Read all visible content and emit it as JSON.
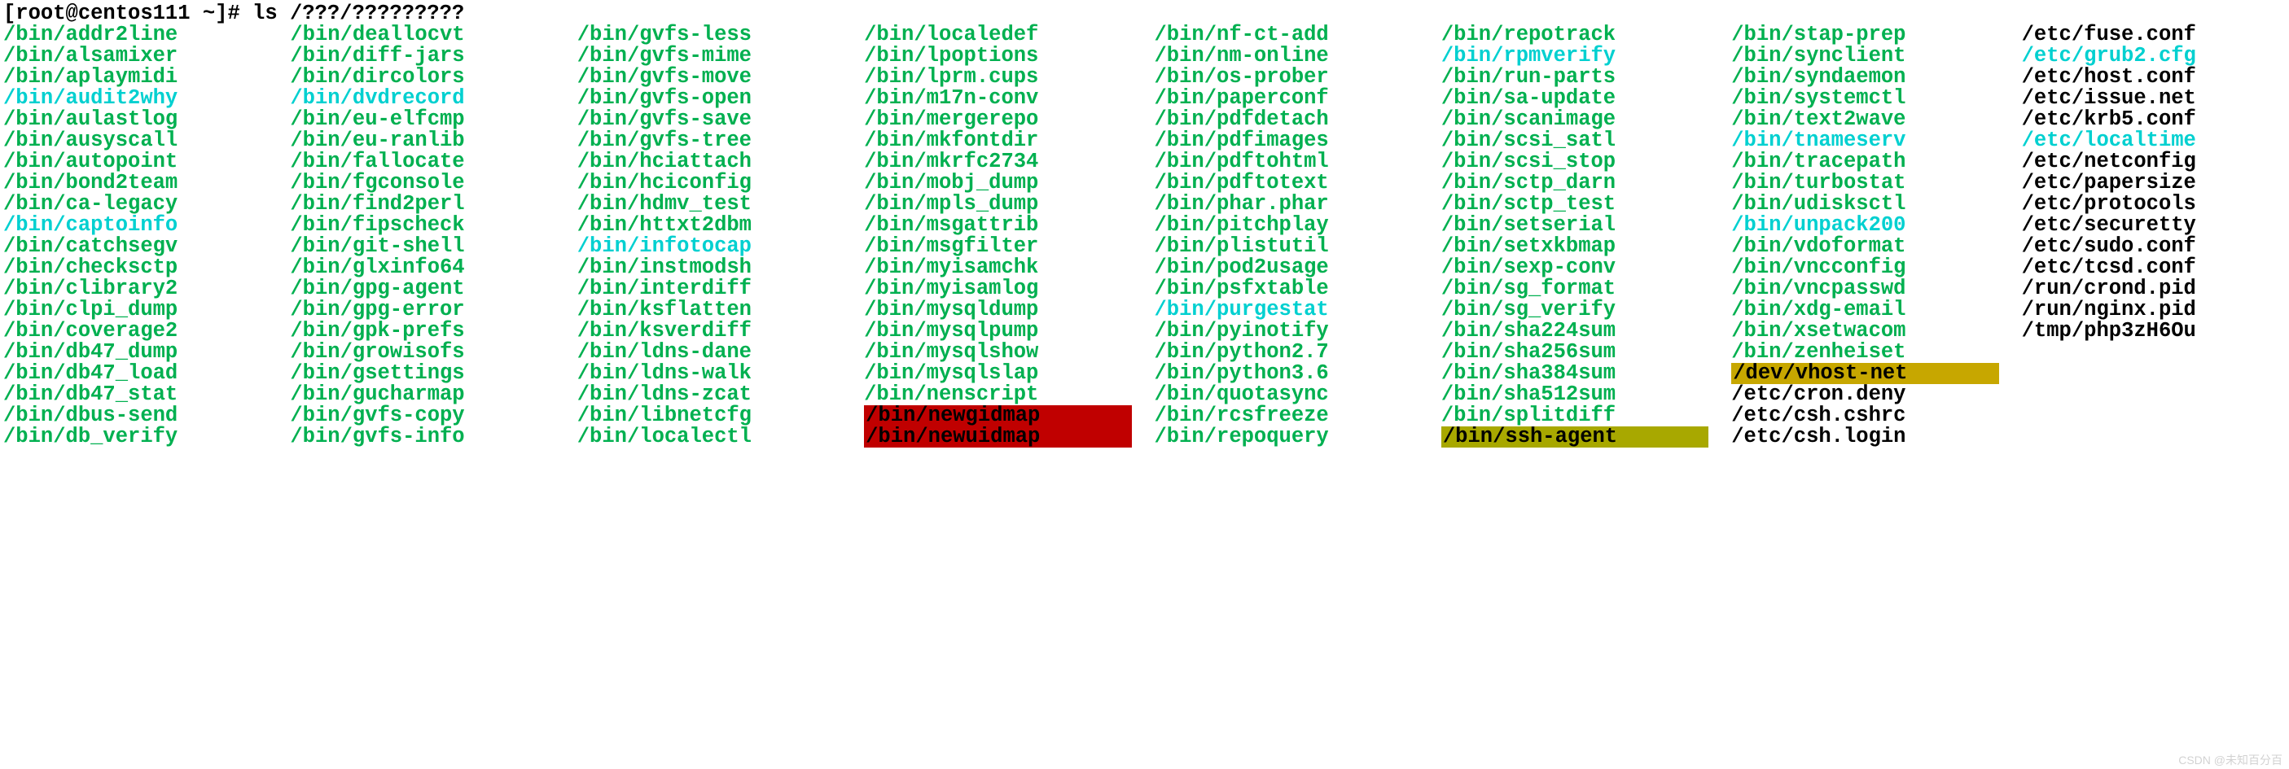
{
  "prompt": "[root@centos111 ~]# ls  /???/?????????",
  "watermark": "CSDN @未知百分百",
  "columns": [
    [
      {
        "text": "/bin/addr2line",
        "cls": "green"
      },
      {
        "text": "/bin/alsamixer",
        "cls": "green"
      },
      {
        "text": "/bin/aplaymidi",
        "cls": "green"
      },
      {
        "text": "/bin/audit2why",
        "cls": "cyan"
      },
      {
        "text": "/bin/aulastlog",
        "cls": "green"
      },
      {
        "text": "/bin/ausyscall",
        "cls": "green"
      },
      {
        "text": "/bin/autopoint",
        "cls": "green"
      },
      {
        "text": "/bin/bond2team",
        "cls": "green"
      },
      {
        "text": "/bin/ca-legacy",
        "cls": "green"
      },
      {
        "text": "/bin/captoinfo",
        "cls": "cyan"
      },
      {
        "text": "/bin/catchsegv",
        "cls": "green"
      },
      {
        "text": "/bin/checksctp",
        "cls": "green"
      },
      {
        "text": "/bin/clibrary2",
        "cls": "green"
      },
      {
        "text": "/bin/clpi_dump",
        "cls": "green"
      },
      {
        "text": "/bin/coverage2",
        "cls": "green"
      },
      {
        "text": "/bin/db47_dump",
        "cls": "green"
      },
      {
        "text": "/bin/db47_load",
        "cls": "green"
      },
      {
        "text": "/bin/db47_stat",
        "cls": "green"
      },
      {
        "text": "/bin/dbus-send",
        "cls": "green"
      },
      {
        "text": "/bin/db_verify",
        "cls": "green"
      }
    ],
    [
      {
        "text": "/bin/deallocvt",
        "cls": "green"
      },
      {
        "text": "/bin/diff-jars",
        "cls": "green"
      },
      {
        "text": "/bin/dircolors",
        "cls": "green"
      },
      {
        "text": "/bin/dvdrecord",
        "cls": "cyan"
      },
      {
        "text": "/bin/eu-elfcmp",
        "cls": "green"
      },
      {
        "text": "/bin/eu-ranlib",
        "cls": "green"
      },
      {
        "text": "/bin/fallocate",
        "cls": "green"
      },
      {
        "text": "/bin/fgconsole",
        "cls": "green"
      },
      {
        "text": "/bin/find2perl",
        "cls": "green"
      },
      {
        "text": "/bin/fipscheck",
        "cls": "green"
      },
      {
        "text": "/bin/git-shell",
        "cls": "green"
      },
      {
        "text": "/bin/glxinfo64",
        "cls": "green"
      },
      {
        "text": "/bin/gpg-agent",
        "cls": "green"
      },
      {
        "text": "/bin/gpg-error",
        "cls": "green"
      },
      {
        "text": "/bin/gpk-prefs",
        "cls": "green"
      },
      {
        "text": "/bin/growisofs",
        "cls": "green"
      },
      {
        "text": "/bin/gsettings",
        "cls": "green"
      },
      {
        "text": "/bin/gucharmap",
        "cls": "green"
      },
      {
        "text": "/bin/gvfs-copy",
        "cls": "green"
      },
      {
        "text": "/bin/gvfs-info",
        "cls": "green"
      }
    ],
    [
      {
        "text": "/bin/gvfs-less",
        "cls": "green"
      },
      {
        "text": "/bin/gvfs-mime",
        "cls": "green"
      },
      {
        "text": "/bin/gvfs-move",
        "cls": "green"
      },
      {
        "text": "/bin/gvfs-open",
        "cls": "green"
      },
      {
        "text": "/bin/gvfs-save",
        "cls": "green"
      },
      {
        "text": "/bin/gvfs-tree",
        "cls": "green"
      },
      {
        "text": "/bin/hciattach",
        "cls": "green"
      },
      {
        "text": "/bin/hciconfig",
        "cls": "green"
      },
      {
        "text": "/bin/hdmv_test",
        "cls": "green"
      },
      {
        "text": "/bin/httxt2dbm",
        "cls": "green"
      },
      {
        "text": "/bin/infotocap",
        "cls": "cyan"
      },
      {
        "text": "/bin/instmodsh",
        "cls": "green"
      },
      {
        "text": "/bin/interdiff",
        "cls": "green"
      },
      {
        "text": "/bin/ksflatten",
        "cls": "green"
      },
      {
        "text": "/bin/ksverdiff",
        "cls": "green"
      },
      {
        "text": "/bin/ldns-dane",
        "cls": "green"
      },
      {
        "text": "/bin/ldns-walk",
        "cls": "green"
      },
      {
        "text": "/bin/ldns-zcat",
        "cls": "green"
      },
      {
        "text": "/bin/libnetcfg",
        "cls": "green"
      },
      {
        "text": "/bin/localectl",
        "cls": "green"
      }
    ],
    [
      {
        "text": "/bin/localedef",
        "cls": "green"
      },
      {
        "text": "/bin/lpoptions",
        "cls": "green"
      },
      {
        "text": "/bin/lprm.cups",
        "cls": "green"
      },
      {
        "text": "/bin/m17n-conv",
        "cls": "green"
      },
      {
        "text": "/bin/mergerepo",
        "cls": "green"
      },
      {
        "text": "/bin/mkfontdir",
        "cls": "green"
      },
      {
        "text": "/bin/mkrfc2734",
        "cls": "green"
      },
      {
        "text": "/bin/mobj_dump",
        "cls": "green"
      },
      {
        "text": "/bin/mpls_dump",
        "cls": "green"
      },
      {
        "text": "/bin/msgattrib",
        "cls": "green"
      },
      {
        "text": "/bin/msgfilter",
        "cls": "green"
      },
      {
        "text": "/bin/myisamchk",
        "cls": "green"
      },
      {
        "text": "/bin/myisamlog",
        "cls": "green"
      },
      {
        "text": "/bin/mysqldump",
        "cls": "green"
      },
      {
        "text": "/bin/mysqlpump",
        "cls": "green"
      },
      {
        "text": "/bin/mysqlshow",
        "cls": "green"
      },
      {
        "text": "/bin/mysqlslap",
        "cls": "green"
      },
      {
        "text": "/bin/nenscript",
        "cls": "green"
      },
      {
        "text": "/bin/newgidmap",
        "cls": "red-bg-black"
      },
      {
        "text": "/bin/newuidmap",
        "cls": "red-bg-black"
      }
    ],
    [
      {
        "text": "/bin/nf-ct-add",
        "cls": "green"
      },
      {
        "text": "/bin/nm-online",
        "cls": "green"
      },
      {
        "text": "/bin/os-prober",
        "cls": "green"
      },
      {
        "text": "/bin/paperconf",
        "cls": "green"
      },
      {
        "text": "/bin/pdfdetach",
        "cls": "green"
      },
      {
        "text": "/bin/pdfimages",
        "cls": "green"
      },
      {
        "text": "/bin/pdftohtml",
        "cls": "green"
      },
      {
        "text": "/bin/pdftotext",
        "cls": "green"
      },
      {
        "text": "/bin/phar.phar",
        "cls": "green"
      },
      {
        "text": "/bin/pitchplay",
        "cls": "green"
      },
      {
        "text": "/bin/plistutil",
        "cls": "green"
      },
      {
        "text": "/bin/pod2usage",
        "cls": "green"
      },
      {
        "text": "/bin/psfxtable",
        "cls": "green"
      },
      {
        "text": "/bin/purgestat",
        "cls": "cyan"
      },
      {
        "text": "/bin/pyinotify",
        "cls": "green"
      },
      {
        "text": "/bin/python2.7",
        "cls": "green"
      },
      {
        "text": "/bin/python3.6",
        "cls": "green"
      },
      {
        "text": "/bin/quotasync",
        "cls": "green"
      },
      {
        "text": "/bin/rcsfreeze",
        "cls": "green"
      },
      {
        "text": "/bin/repoquery",
        "cls": "green"
      }
    ],
    [
      {
        "text": "/bin/repotrack",
        "cls": "green"
      },
      {
        "text": "/bin/rpmverify",
        "cls": "cyan"
      },
      {
        "text": "/bin/run-parts",
        "cls": "green"
      },
      {
        "text": "/bin/sa-update",
        "cls": "green"
      },
      {
        "text": "/bin/scanimage",
        "cls": "green"
      },
      {
        "text": "/bin/scsi_satl",
        "cls": "green"
      },
      {
        "text": "/bin/scsi_stop",
        "cls": "green"
      },
      {
        "text": "/bin/sctp_darn",
        "cls": "green"
      },
      {
        "text": "/bin/sctp_test",
        "cls": "green"
      },
      {
        "text": "/bin/setserial",
        "cls": "green"
      },
      {
        "text": "/bin/setxkbmap",
        "cls": "green"
      },
      {
        "text": "/bin/sexp-conv",
        "cls": "green"
      },
      {
        "text": "/bin/sg_format",
        "cls": "green"
      },
      {
        "text": "/bin/sg_verify",
        "cls": "green"
      },
      {
        "text": "/bin/sha224sum",
        "cls": "green"
      },
      {
        "text": "/bin/sha256sum",
        "cls": "green"
      },
      {
        "text": "/bin/sha384sum",
        "cls": "green"
      },
      {
        "text": "/bin/sha512sum",
        "cls": "green"
      },
      {
        "text": "/bin/splitdiff",
        "cls": "green"
      },
      {
        "text": "/bin/ssh-agent",
        "cls": "olive-bg-black"
      }
    ],
    [
      {
        "text": "/bin/stap-prep",
        "cls": "green"
      },
      {
        "text": "/bin/synclient",
        "cls": "green"
      },
      {
        "text": "/bin/syndaemon",
        "cls": "green"
      },
      {
        "text": "/bin/systemctl",
        "cls": "green"
      },
      {
        "text": "/bin/text2wave",
        "cls": "green"
      },
      {
        "text": "/bin/tnameserv",
        "cls": "cyan"
      },
      {
        "text": "/bin/tracepath",
        "cls": "green"
      },
      {
        "text": "/bin/turbostat",
        "cls": "green"
      },
      {
        "text": "/bin/udisksctl",
        "cls": "green"
      },
      {
        "text": "/bin/unpack200",
        "cls": "cyan"
      },
      {
        "text": "/bin/vdoformat",
        "cls": "green"
      },
      {
        "text": "/bin/vncconfig",
        "cls": "green"
      },
      {
        "text": "/bin/vncpasswd",
        "cls": "green"
      },
      {
        "text": "/bin/xdg-email",
        "cls": "green"
      },
      {
        "text": "/bin/xsetwacom",
        "cls": "green"
      },
      {
        "text": "/bin/zenheiset",
        "cls": "green"
      },
      {
        "text": "/dev/vhost-net",
        "cls": "yellow-bg-black"
      },
      {
        "text": "/etc/cron.deny",
        "cls": "black"
      },
      {
        "text": "/etc/csh.cshrc",
        "cls": "black"
      },
      {
        "text": "/etc/csh.login",
        "cls": "black"
      }
    ],
    [
      {
        "text": "/etc/fuse.conf",
        "cls": "black"
      },
      {
        "text": "/etc/grub2.cfg",
        "cls": "cyan"
      },
      {
        "text": "/etc/host.conf",
        "cls": "black"
      },
      {
        "text": "/etc/issue.net",
        "cls": "black"
      },
      {
        "text": "/etc/krb5.conf",
        "cls": "black"
      },
      {
        "text": "/etc/localtime",
        "cls": "cyan"
      },
      {
        "text": "/etc/netconfig",
        "cls": "black"
      },
      {
        "text": "/etc/papersize",
        "cls": "black"
      },
      {
        "text": "/etc/protocols",
        "cls": "black"
      },
      {
        "text": "/etc/securetty",
        "cls": "black"
      },
      {
        "text": "/etc/sudo.conf",
        "cls": "black"
      },
      {
        "text": "/etc/tcsd.conf",
        "cls": "black"
      },
      {
        "text": "/run/crond.pid",
        "cls": "black"
      },
      {
        "text": "/run/nginx.pid",
        "cls": "black"
      },
      {
        "text": "/tmp/php3zH6Ou",
        "cls": "black"
      }
    ]
  ]
}
